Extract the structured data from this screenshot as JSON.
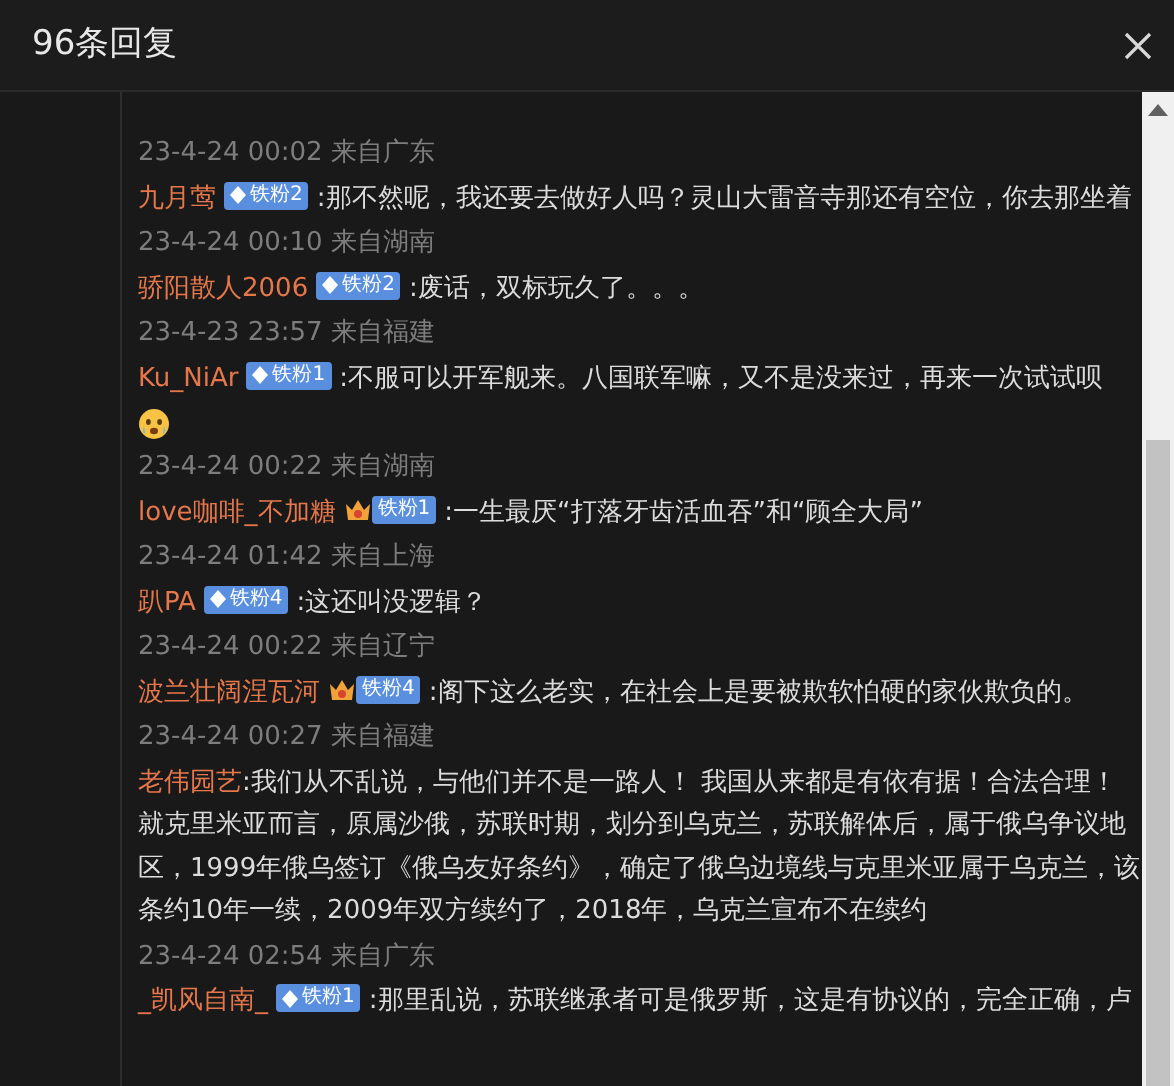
{
  "dialog": {
    "title": "96条回复"
  },
  "replies": [
    {
      "time": "23-4-24 00:02 来自广东"
    },
    {
      "name": "九月莺",
      "badge": {
        "kind": "diamond",
        "label": "铁粉2"
      },
      "text": ":那不然呢，我还要去做好人吗？灵山大雷音寺那还有空位，你去那坐着",
      "time": "23-4-24 00:10 来自湖南"
    },
    {
      "name": "骄阳散人2006",
      "badge": {
        "kind": "diamond",
        "label": "铁粉2"
      },
      "text": ":废话，双标玩久了。。。",
      "time": "23-4-23 23:57 来自福建"
    },
    {
      "name": "Ku_NiAr",
      "badge": {
        "kind": "diamond",
        "label": "铁粉1"
      },
      "text": ":不服可以开军舰来。八国联军嘛，又不是没来过，再来一次试试呗",
      "sticker": true,
      "time": "23-4-24 00:22 来自湖南"
    },
    {
      "name": "love咖啡_不加糖",
      "badge": {
        "kind": "crown",
        "label": "铁粉1"
      },
      "text": ":一生最厌“打落牙齿活血吞”和“顾全大局”",
      "time": "23-4-24 01:42 来自上海"
    },
    {
      "name": "趴PA",
      "badge": {
        "kind": "diamond",
        "label": "铁粉4"
      },
      "text": ":这还叫没逻辑？",
      "time": "23-4-24 00:22 来自辽宁"
    },
    {
      "name": "波兰壮阔涅瓦河",
      "badge": {
        "kind": "crown",
        "label": "铁粉4"
      },
      "text": ":阁下这么老实，在社会上是要被欺软怕硬的家伙欺负的。",
      "time": "23-4-24 00:27 来自福建"
    },
    {
      "name": "老伟园艺",
      "text": ":我们从不乱说，与他们并不是一路人！ 我国从来都是有依有据！合法合理！就克里米亚而言，原属沙俄，苏联时期，划分到乌克兰，苏联解体后，属于俄乌争议地区，1999年俄乌签订《俄乌友好条约》，确定了俄乌边境线与克里米亚属于乌克兰，该条约10年一续，2009年双方续约了，2018年，乌克兰宣布不在续约",
      "time": "23-4-24 02:54 来自广东"
    },
    {
      "name": "_凯风自南_",
      "badge": {
        "kind": "diamond",
        "label": "铁粉1"
      },
      "text": ":那里乱说，苏联继承者可是俄罗斯，这是有协议的，完全正确，卢"
    }
  ]
}
